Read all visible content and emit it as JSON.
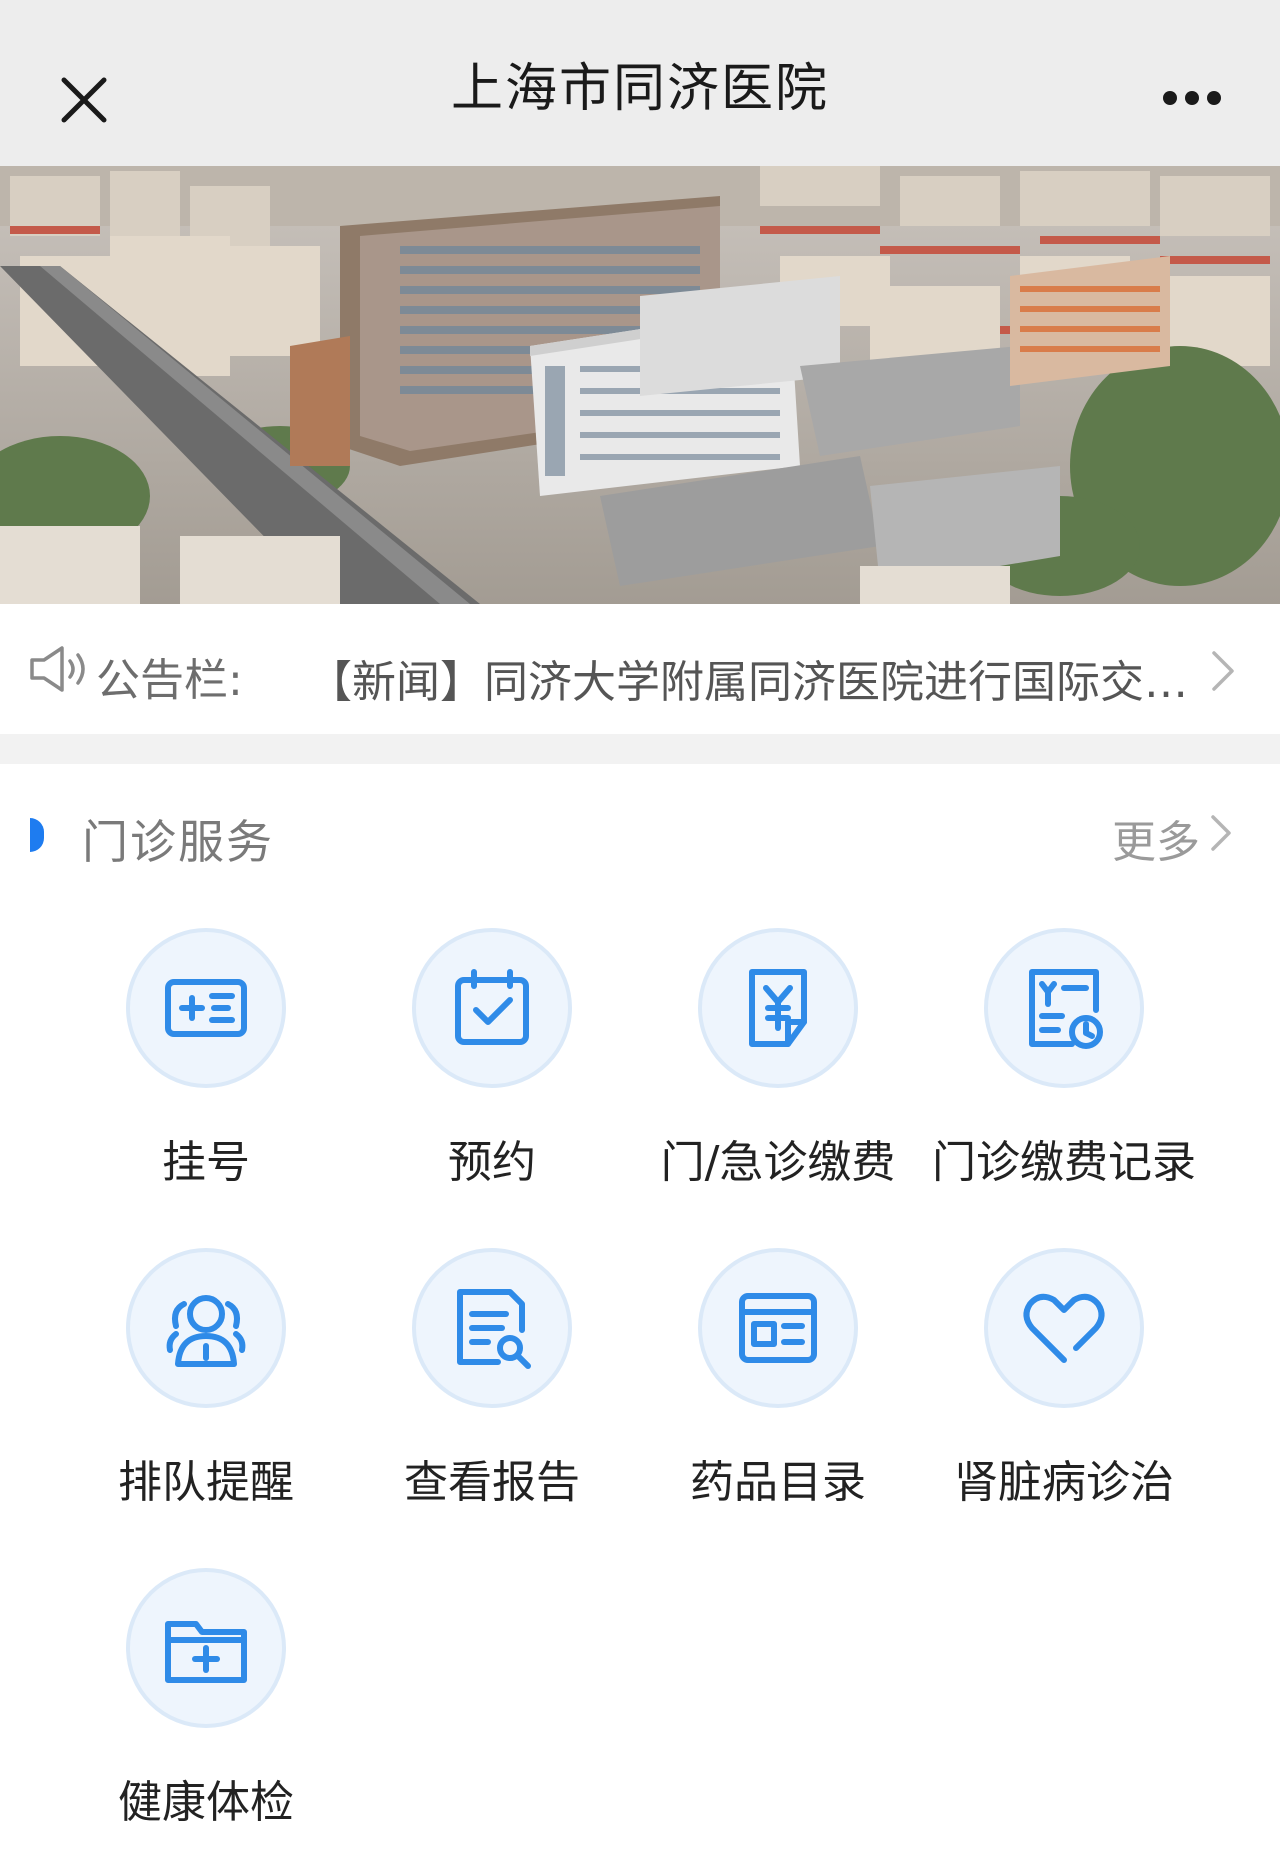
{
  "nav": {
    "title": "上海市同济医院",
    "close_icon": "close-icon",
    "more_icon": "more-dots-icon"
  },
  "banner": {
    "image": "hospital-aerial-photo",
    "active_slide": 1
  },
  "notice": {
    "icon": "speaker-icon",
    "label": "公告栏:",
    "text": "【新闻】同济大学附属同济医院进行国际交…"
  },
  "section": {
    "title": "门诊服务",
    "more": "更多"
  },
  "services": [
    {
      "label": "挂号",
      "icon": "registration-card-icon"
    },
    {
      "label": "预约",
      "icon": "calendar-check-icon"
    },
    {
      "label": "门/急诊缴费",
      "icon": "payment-document-icon"
    },
    {
      "label": "门诊缴费记录",
      "icon": "payment-record-icon"
    },
    {
      "label": "排队提醒",
      "icon": "queue-people-icon"
    },
    {
      "label": "查看报告",
      "icon": "report-search-icon"
    },
    {
      "label": "药品目录",
      "icon": "drug-catalog-icon"
    },
    {
      "label": "肾脏病诊治",
      "icon": "heart-icon"
    },
    {
      "label": "健康体检",
      "icon": "medical-folder-icon"
    }
  ],
  "colors": {
    "accent": "#1e7cf0",
    "icon_stroke": "#2f8be8",
    "nav_bg": "#ededed"
  }
}
